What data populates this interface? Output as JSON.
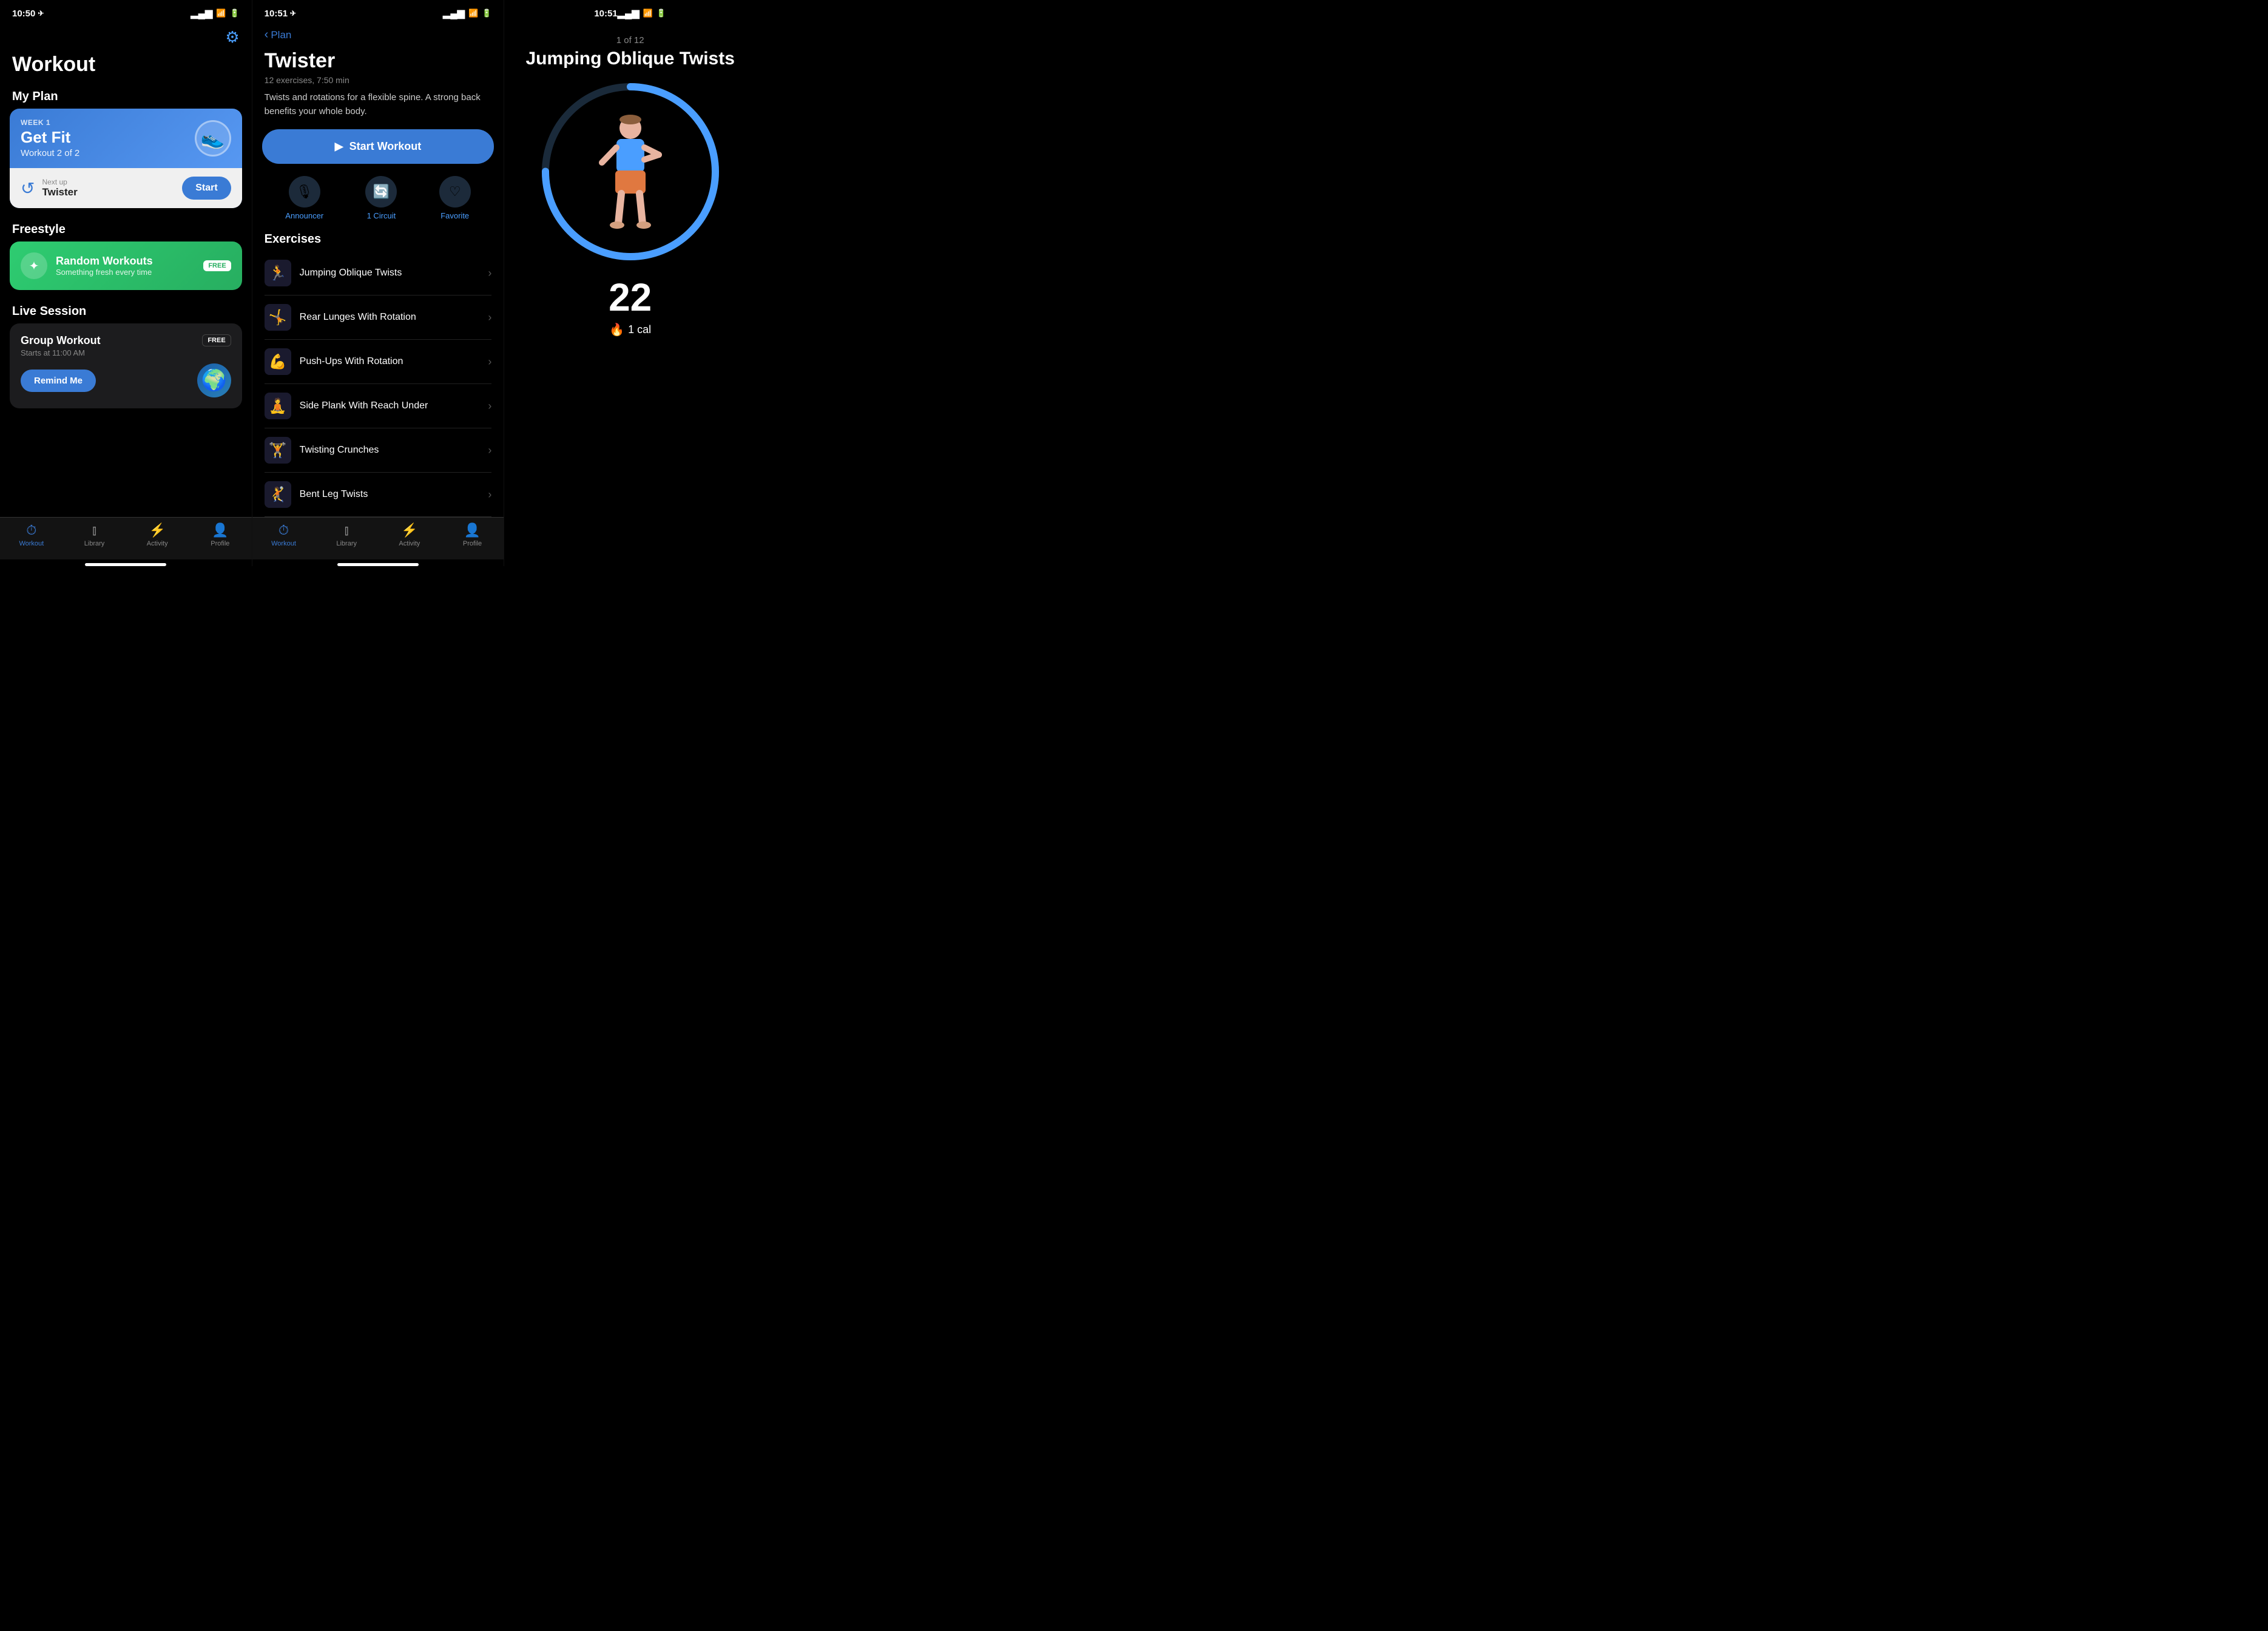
{
  "panel1": {
    "statusBar": {
      "time": "10:50",
      "locationArrow": "▶",
      "signal": "▂▄▆",
      "wifi": "wifi",
      "battery": "battery"
    },
    "pageTitle": "Workout",
    "settingsIcon": "⚙",
    "myPlanLabel": "My Plan",
    "planCard": {
      "weekLabel": "WEEK 1",
      "planName": "Get Fit",
      "workoutProgress": "Workout 2 of 2",
      "shoeEmoji": "👟",
      "nextUpLabel": "Next up",
      "nextUpName": "Twister",
      "startLabel": "Start"
    },
    "freestyleLabel": "Freestyle",
    "freestyleCard": {
      "name": "Random Workouts",
      "subtitle": "Something fresh every time",
      "freeBadge": "FREE"
    },
    "liveSessionLabel": "Live Session",
    "liveCard": {
      "title": "Group Workout",
      "time": "Starts at 11:00 AM",
      "freeBadge": "FREE",
      "remindLabel": "Remind Me",
      "globeEmoji": "🌍"
    },
    "tabBar": {
      "items": [
        {
          "icon": "🕐",
          "label": "Workout",
          "active": true
        },
        {
          "icon": "📚",
          "label": "Library",
          "active": false
        },
        {
          "icon": "⚡",
          "label": "Activity",
          "active": false
        },
        {
          "icon": "👤",
          "label": "Profile",
          "active": false
        }
      ]
    }
  },
  "panel2": {
    "statusBar": {
      "time": "10:51",
      "locationArrow": "▶"
    },
    "backLabel": "Plan",
    "workoutTitle": "Twister",
    "workoutMeta": "12 exercises, 7:50 min",
    "workoutDesc": "Twists and rotations for a flexible spine. A strong back benefits your whole body.",
    "startWorkoutLabel": "Start Workout",
    "options": [
      {
        "icon": "🎙",
        "label": "Announcer"
      },
      {
        "icon": "🔄",
        "label": "1 Circuit"
      },
      {
        "icon": "♡",
        "label": "Favorite"
      }
    ],
    "exercisesLabel": "Exercises",
    "exercises": [
      {
        "name": "Jumping Oblique Twists",
        "emoji": "🏃"
      },
      {
        "name": "Rear Lunges With Rotation",
        "emoji": "🤸"
      },
      {
        "name": "Push-Ups With Rotation",
        "emoji": "💪"
      },
      {
        "name": "Side Plank With Reach Under",
        "emoji": "🧘"
      },
      {
        "name": "Twisting Crunches",
        "emoji": "🏋"
      },
      {
        "name": "Bent Leg Twists",
        "emoji": "🤾"
      }
    ],
    "tabBar": {
      "items": [
        {
          "icon": "🕐",
          "label": "Workout",
          "active": true
        },
        {
          "icon": "📚",
          "label": "Library",
          "active": false
        },
        {
          "icon": "⚡",
          "label": "Activity",
          "active": false
        },
        {
          "icon": "👤",
          "label": "Profile",
          "active": false
        }
      ]
    }
  },
  "panel3": {
    "statusBar": {
      "time": "10:51"
    },
    "exerciseCounter": "1 of 12",
    "exerciseName": "Jumping Oblique Twists",
    "progressPercent": 75,
    "repCount": "22",
    "calLabel": "1 cal",
    "fireEmoji": "🔥"
  }
}
